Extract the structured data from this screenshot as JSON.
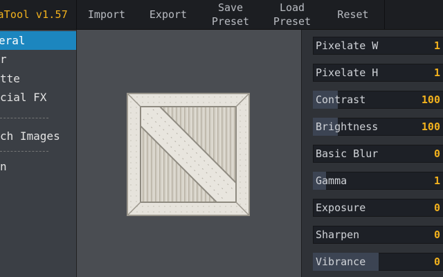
{
  "app": {
    "title": "aTool v1.57"
  },
  "menu": {
    "import": "Import",
    "export": "Export",
    "save_preset": "Save\nPreset",
    "load_preset": "Load\nPreset",
    "reset": "Reset"
  },
  "sidebar": {
    "items": [
      {
        "label": "eral",
        "active": true
      },
      {
        "label": "r",
        "active": false
      },
      {
        "label": "tte",
        "active": false
      },
      {
        "label": "cial FX",
        "active": false
      },
      {
        "label": "ch Images",
        "active": false
      },
      {
        "label": "n",
        "active": false
      }
    ]
  },
  "preview": {
    "image": "wooden-crate-texture"
  },
  "sliders": [
    {
      "label": "Pixelate W",
      "value": "1",
      "fill_fraction": 0.0
    },
    {
      "label": "Pixelate H",
      "value": "1",
      "fill_fraction": 0.0
    },
    {
      "label": "Contrast",
      "value": "100",
      "fill_fraction": 0.19
    },
    {
      "label": "Brightness",
      "value": "100",
      "fill_fraction": 0.19
    },
    {
      "label": "Basic Blur",
      "value": "0",
      "fill_fraction": 0.0
    },
    {
      "label": "Gamma",
      "value": "1",
      "fill_fraction": 0.1
    },
    {
      "label": "Exposure",
      "value": "0",
      "fill_fraction": 0.0
    },
    {
      "label": "Sharpen",
      "value": "0",
      "fill_fraction": 0.0
    },
    {
      "label": "Vibrance",
      "value": "0",
      "fill_fraction": 0.5
    }
  ],
  "colors": {
    "accent": "#f3b21d",
    "active": "#1c86bf",
    "background": "#2b2e33"
  }
}
